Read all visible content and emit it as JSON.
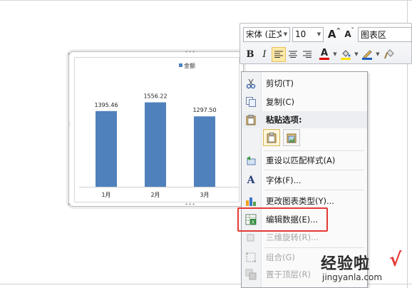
{
  "chart_data": {
    "type": "bar",
    "categories": [
      "1月",
      "2月",
      "3月"
    ],
    "series": [
      {
        "name": "金额",
        "values": [
          1395.46,
          1556.22,
          1297.5
        ],
        "labels": [
          "1395.46",
          "1556.22",
          "1297.50"
        ]
      }
    ],
    "ylim": [
      0,
      1800
    ],
    "grid": false,
    "legend": "top",
    "colors": {
      "bar": "#4f81bd"
    }
  },
  "mini_toolbar": {
    "font_name": "宋体 (正文",
    "font_size": "10",
    "grow_font": "A",
    "shrink_font": "A",
    "element_selector": "图表区",
    "bold": "B",
    "italic": "I",
    "font_color_letter": "A",
    "colors": {
      "font_color_bar": "#e00000",
      "fill_bar": "#ffe000",
      "outline_bar": "#1f5fbf"
    }
  },
  "context_menu": {
    "cut": "剪切(T)",
    "copy": "复制(C)",
    "paste_options": "粘贴选项:",
    "reset_style": "重设以匹配样式(A)",
    "font": "字体(F)...",
    "change_type": "更改图表类型(Y)...",
    "edit_data": "编辑数据(E)...",
    "rotate_3d": "三维旋转(R)...",
    "group": "组合(G)",
    "bring_front": "置于顶层(R)"
  },
  "watermark": {
    "name": "经验啦",
    "check": "√",
    "url": "jingyanla.com"
  }
}
